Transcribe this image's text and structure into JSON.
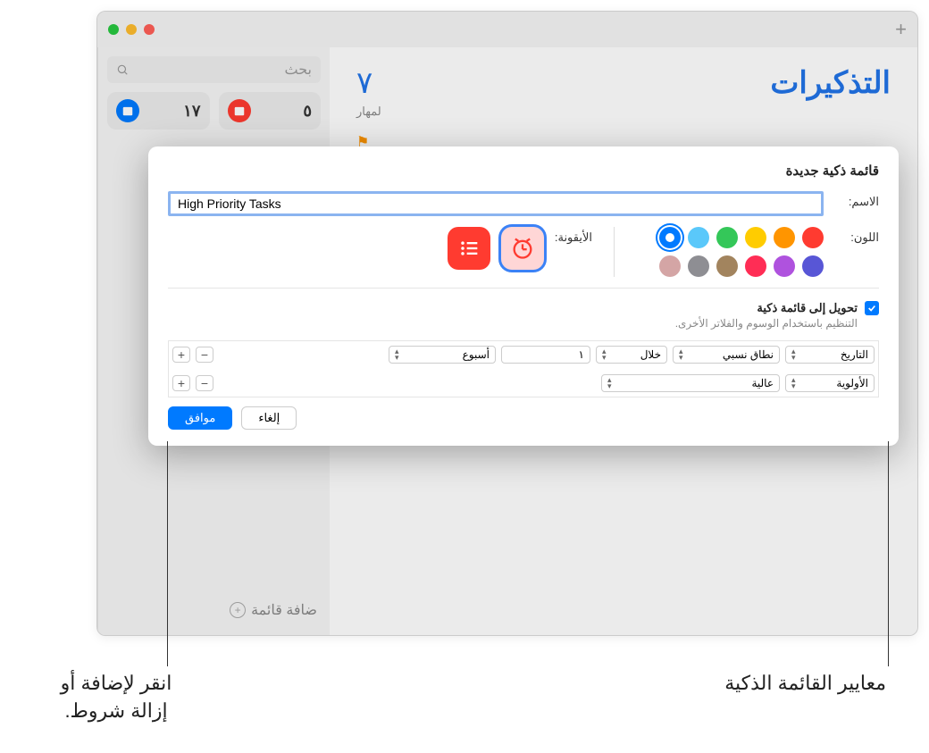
{
  "window": {
    "add_icon": "+"
  },
  "sidebar": {
    "search_placeholder": "بحث",
    "cards": [
      {
        "count": "٥",
        "color": "#ff3b30"
      },
      {
        "count": "١٧",
        "color": "#007aff"
      }
    ],
    "add_list": "ضافة قائمة"
  },
  "content": {
    "title": "التذكيرات",
    "count": "٧",
    "show_done": "لمهار"
  },
  "dialog": {
    "title": "قائمة ذكية جديدة",
    "name_label": "الاسم:",
    "name_value": "High Priority Tasks",
    "color_label": "اللون:",
    "icon_label": "الأيقونة:",
    "colors": {
      "row1": [
        "#ff3b30",
        "#ff9500",
        "#ffcc00",
        "#34c759",
        "#5ac8fa",
        "#007aff"
      ],
      "row2": [
        "#5856d6",
        "#af52de",
        "#ff2d55",
        "#a2845e",
        "#8e8e93",
        "#d4a5a5"
      ]
    },
    "selected_color_index": 5,
    "checkbox_label": "تحويل إلى قائمة ذكية",
    "checkbox_sub": "التنظيم باستخدام الوسوم والفلاتر الأخرى.",
    "filters": [
      {
        "type": "التاريخ",
        "range": "نطاق نسبي",
        "within": "خلال",
        "num": "١",
        "unit": "أسبوع"
      },
      {
        "type": "الأولوية",
        "value": "عالية"
      }
    ],
    "cancel": "إلغاء",
    "ok": "موافق"
  },
  "callouts": {
    "right": "معايير القائمة الذكية",
    "left_l1": "انقر لإضافة أو",
    "left_l2": "إزالة شروط."
  }
}
